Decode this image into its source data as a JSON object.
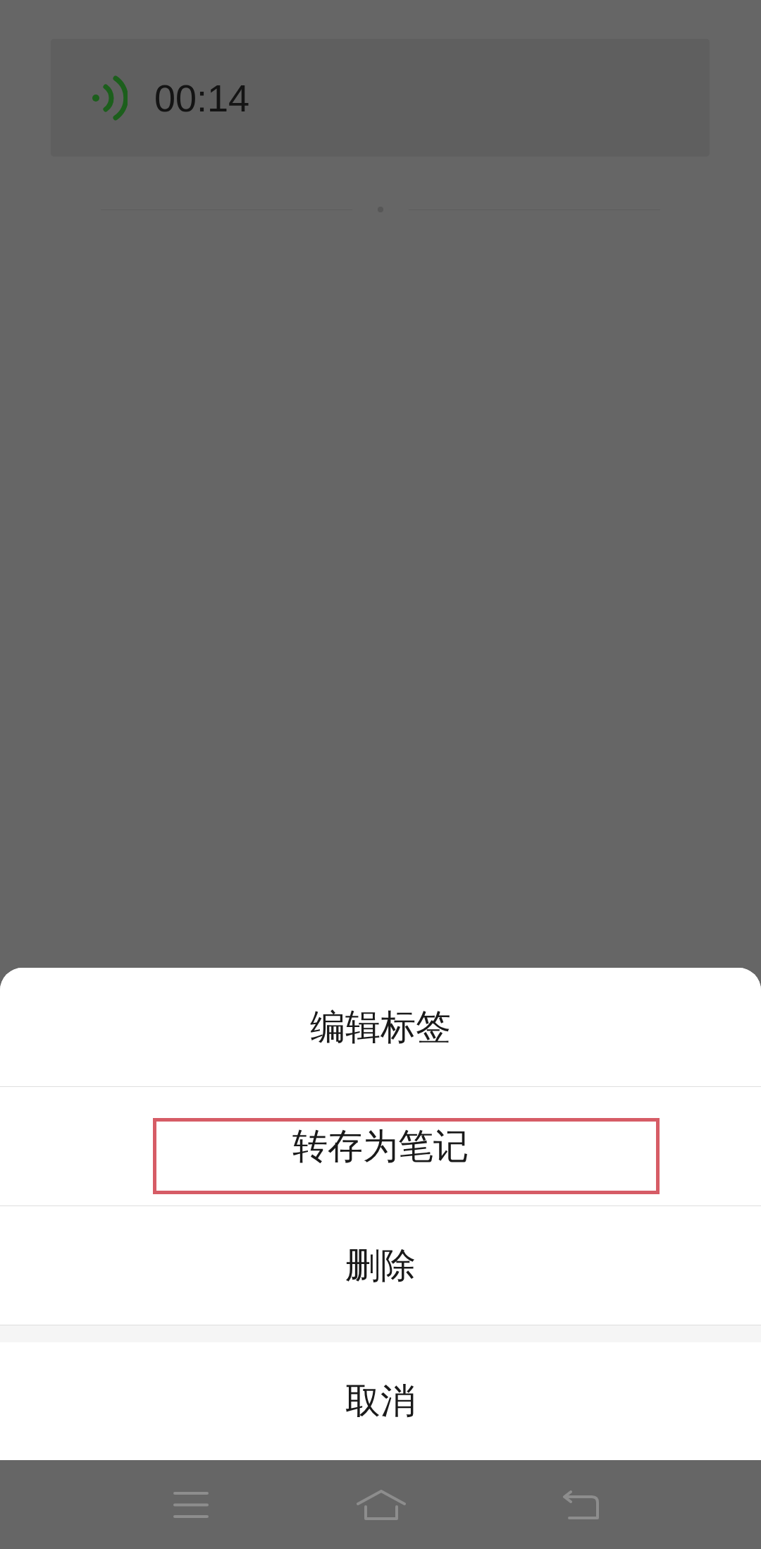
{
  "voice_message": {
    "duration": "00:14"
  },
  "action_sheet": {
    "items": [
      {
        "label": "编辑标签",
        "annotated": false
      },
      {
        "label": "转存为笔记",
        "annotated": true
      },
      {
        "label": "删除",
        "annotated": false
      }
    ],
    "cancel": {
      "label": "取消"
    }
  }
}
